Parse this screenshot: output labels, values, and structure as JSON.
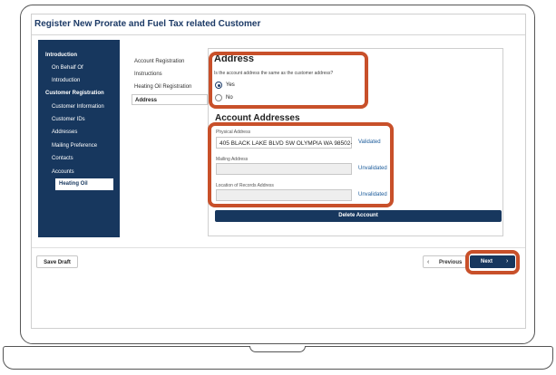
{
  "window": {
    "title": "Register New Prorate and Fuel Tax related Customer"
  },
  "sidebar": {
    "items": [
      {
        "label": "Introduction",
        "heading": true
      },
      {
        "label": "On Behalf Of"
      },
      {
        "label": "Introduction"
      },
      {
        "label": "Customer Registration",
        "heading": true
      },
      {
        "label": "Customer Information"
      },
      {
        "label": "Customer IDs"
      },
      {
        "label": "Addresses"
      },
      {
        "label": "Mailing Preference"
      },
      {
        "label": "Contacts"
      },
      {
        "label": "Accounts"
      },
      {
        "label": "Heating Oil",
        "active": true
      }
    ]
  },
  "subnav": {
    "items": [
      {
        "label": "Account Registration"
      },
      {
        "label": "Instructions"
      },
      {
        "label": "Heating Oil Registration"
      },
      {
        "label": "Address",
        "active": true
      }
    ]
  },
  "address_section": {
    "heading": "Address",
    "question": "Is the account address the same as the customer address?",
    "options": [
      {
        "label": "Yes",
        "selected": true
      },
      {
        "label": "No",
        "selected": false
      }
    ]
  },
  "account_addresses": {
    "heading": "Account Addresses",
    "fields": [
      {
        "label": "Physical Address",
        "value": "405 BLACK LAKE BLVD SW OLYMPIA WA 98502-5",
        "status": "Validated"
      },
      {
        "label": "Mailing Address",
        "value": "",
        "status": "Unvalidated"
      },
      {
        "label": "Location of Records Address",
        "value": "",
        "status": "Unvalidated"
      }
    ],
    "delete_label": "Delete Account"
  },
  "footer": {
    "save_draft_label": "Save Draft",
    "previous_label": "Previous",
    "next_label": "Next"
  },
  "icons": {
    "previous": "chevron-left-icon",
    "next": "chevron-right-icon"
  },
  "colors": {
    "navy": "#17375e",
    "highlight": "#c8502a",
    "link": "#1a5a9a"
  }
}
